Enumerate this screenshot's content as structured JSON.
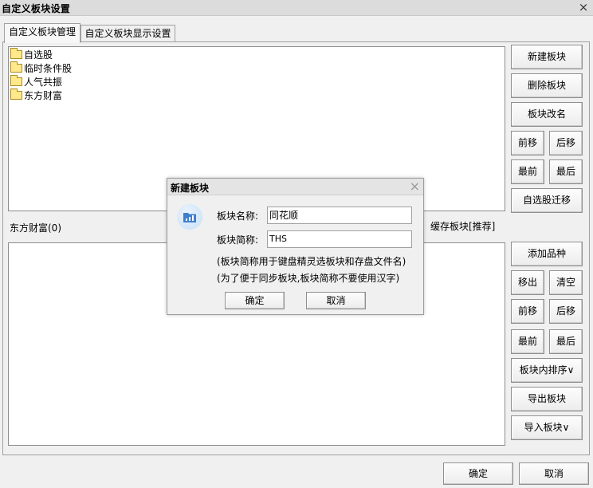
{
  "window": {
    "title": "自定义板块设置",
    "close": "×"
  },
  "tabs": [
    {
      "label": "自定义板块管理",
      "active": true
    },
    {
      "label": "自定义板块显示设置",
      "active": false
    }
  ],
  "block_list": [
    "自选股",
    "临时条件股",
    "人气共振",
    "东方财富"
  ],
  "top_buttons": {
    "new_block": "新建板块",
    "delete_block": "删除板块",
    "rename_block": "板块改名",
    "move_up": "前移",
    "move_down": "后移",
    "move_first": "最前",
    "move_last": "最后",
    "migrate": "自选股迁移"
  },
  "selected_block_label": "东方财富(0)",
  "cache_label": "缓存板块[推荐]",
  "bottom_buttons": {
    "add_stock": "添加品种",
    "remove": "移出",
    "clear": "清空",
    "move_up": "前移",
    "move_down": "后移",
    "move_first": "最前",
    "move_last": "最后",
    "sort": "板块内排序∨",
    "export": "导出板块",
    "import": "导入板块∨"
  },
  "footer": {
    "ok": "确定",
    "cancel": "取消"
  },
  "dialog": {
    "title": "新建板块",
    "close": "×",
    "name_label": "板块名称:",
    "name_value": "同花顺",
    "abbr_label": "板块简称:",
    "abbr_value": "THS",
    "note1": "(板块简称用于键盘精灵选板块和存盘文件名)",
    "note2": "(为了便于同步板块,板块简称不要使用汉字)",
    "ok": "确定",
    "cancel": "取消"
  },
  "colors": {
    "folder": "#ffe98a",
    "dialog_icon": "#3f7fd0"
  }
}
